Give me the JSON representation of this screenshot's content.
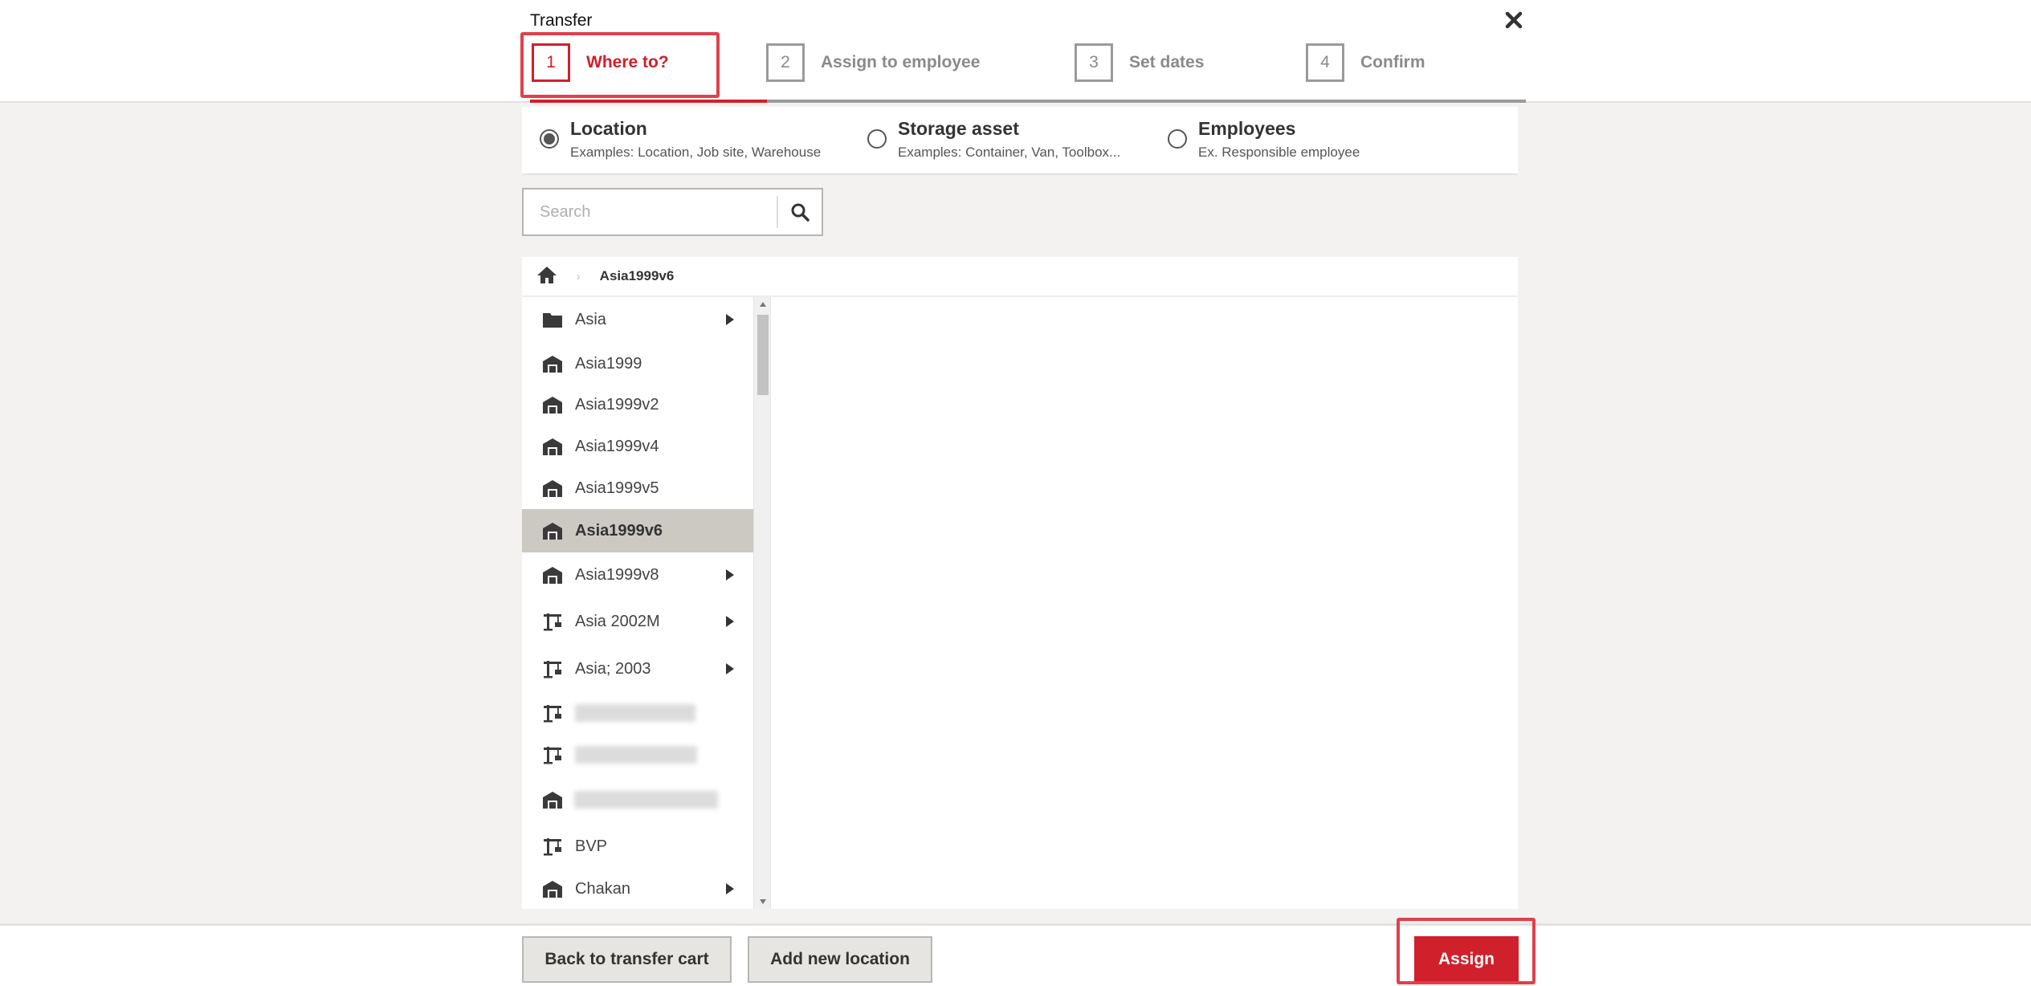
{
  "modal": {
    "title": "Transfer"
  },
  "steps": [
    {
      "num": "1",
      "label": "Where to?"
    },
    {
      "num": "2",
      "label": "Assign to employee"
    },
    {
      "num": "3",
      "label": "Set dates"
    },
    {
      "num": "4",
      "label": "Confirm"
    }
  ],
  "destination_types": [
    {
      "title": "Location",
      "sub": "Examples: Location, Job site, Warehouse",
      "selected": true
    },
    {
      "title": "Storage asset",
      "sub": "Examples: Container, Van, Toolbox...",
      "selected": false
    },
    {
      "title": "Employees",
      "sub": "Ex. Responsible employee",
      "selected": false
    }
  ],
  "search": {
    "placeholder": "Search",
    "value": ""
  },
  "breadcrumb": {
    "current": "Asia1999v6"
  },
  "locations": [
    {
      "label": "Asia",
      "icon": "folder-icon",
      "has_children": true
    },
    {
      "label": "Asia1999",
      "icon": "warehouse-icon",
      "has_children": false
    },
    {
      "label": "Asia1999v2",
      "icon": "warehouse-icon",
      "has_children": false
    },
    {
      "label": "Asia1999v4",
      "icon": "warehouse-icon",
      "has_children": false
    },
    {
      "label": "Asia1999v5",
      "icon": "warehouse-icon",
      "has_children": false
    },
    {
      "label": "Asia1999v6",
      "icon": "warehouse-icon",
      "has_children": false,
      "selected": true
    },
    {
      "label": "Asia1999v8",
      "icon": "warehouse-icon",
      "has_children": true
    },
    {
      "label": "Asia 2002M",
      "icon": "jobsite-crane-icon",
      "has_children": true
    },
    {
      "label": "Asia; 2003",
      "icon": "jobsite-crane-icon",
      "has_children": true
    },
    {
      "label": "",
      "icon": "jobsite-crane-icon",
      "has_children": false,
      "redacted": true
    },
    {
      "label": "",
      "icon": "jobsite-crane-icon",
      "has_children": false,
      "redacted": true
    },
    {
      "label": "",
      "icon": "warehouse-icon",
      "has_children": false,
      "redacted": true
    },
    {
      "label": "BVP",
      "icon": "jobsite-crane-icon",
      "has_children": false
    },
    {
      "label": "Chakan",
      "icon": "warehouse-icon",
      "has_children": true
    }
  ],
  "footer": {
    "back_label": "Back to transfer cart",
    "add_label": "Add new location",
    "assign_label": "Assign"
  },
  "colors": {
    "accent": "#d0202c",
    "selected_row": "#ccc9c3",
    "inactive_step": "#9a9a9a"
  }
}
